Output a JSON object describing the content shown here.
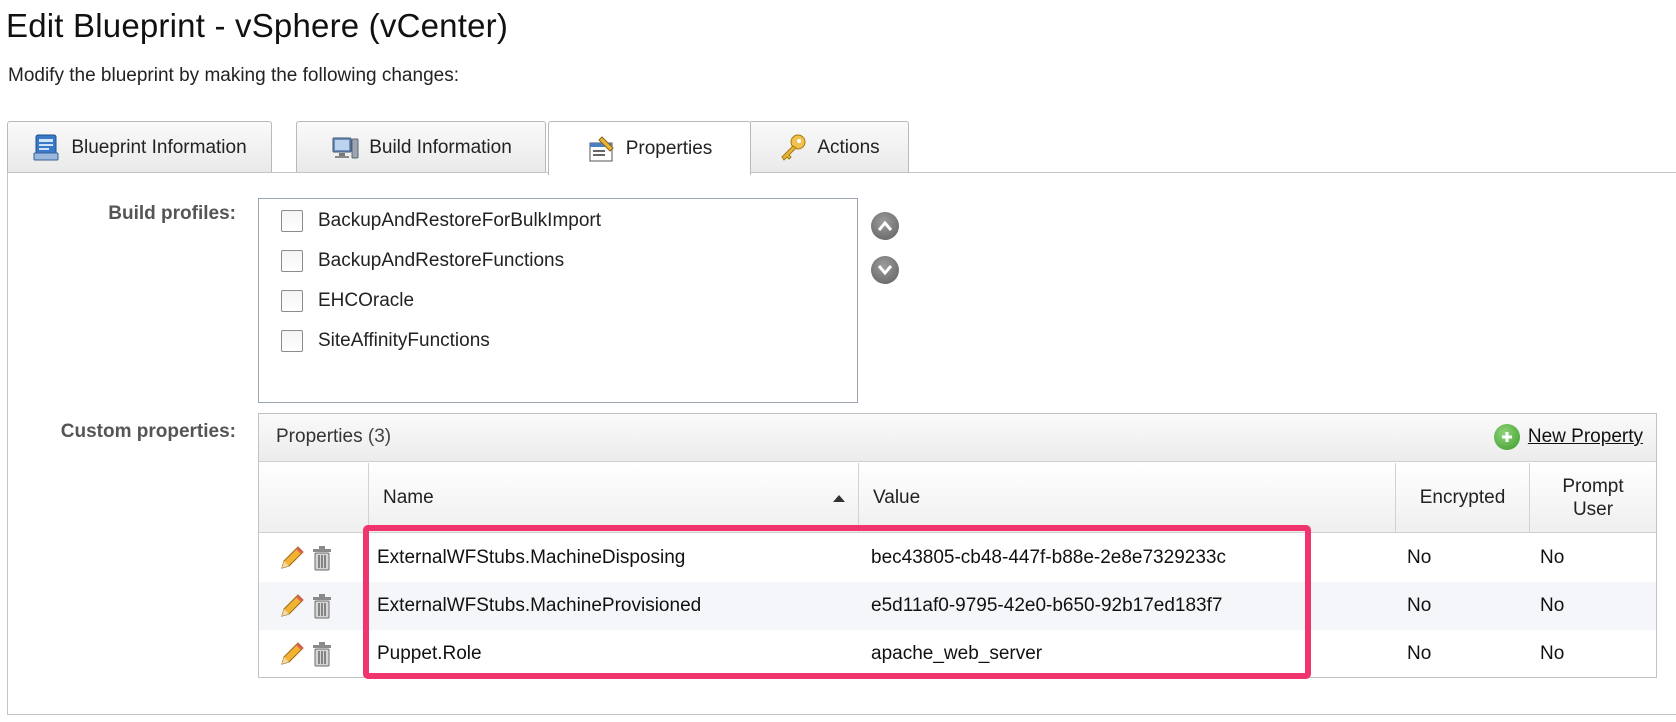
{
  "page": {
    "title": "Edit Blueprint - vSphere (vCenter)",
    "subtitle": "Modify the blueprint by making the following changes:"
  },
  "tabs": [
    {
      "label": "Blueprint Information",
      "icon": "blueprint-icon",
      "active": false
    },
    {
      "label": "Build Information",
      "icon": "build-computer-icon",
      "active": false
    },
    {
      "label": "Properties",
      "icon": "properties-icon",
      "active": true
    },
    {
      "label": "Actions",
      "icon": "key-icon",
      "active": false
    }
  ],
  "build_profiles": {
    "label": "Build profiles:",
    "items": [
      {
        "label": "BackupAndRestoreForBulkImport",
        "checked": false
      },
      {
        "label": "BackupAndRestoreFunctions",
        "checked": false
      },
      {
        "label": "EHCOracle",
        "checked": false
      },
      {
        "label": "SiteAffinityFunctions",
        "checked": false
      }
    ]
  },
  "custom_properties": {
    "label": "Custom properties:",
    "grid_title": "Properties",
    "grid_count": "(3)",
    "new_property_label": "New Property",
    "columns": {
      "name": "Name",
      "value": "Value",
      "encrypted": "Encrypted",
      "prompt_user": "Prompt User"
    },
    "sort": {
      "column": "Name",
      "direction": "ascending"
    },
    "rows": [
      {
        "name": "ExternalWFStubs.MachineDisposing",
        "value": "bec43805-cb48-447f-b88e-2e8e7329233c",
        "encrypted": "No",
        "prompt_user": "No"
      },
      {
        "name": "ExternalWFStubs.MachineProvisioned",
        "value": "e5d11af0-9795-42e0-b650-92b17ed183f7",
        "encrypted": "No",
        "prompt_user": "No"
      },
      {
        "name": "Puppet.Role",
        "value": "apache_web_server",
        "encrypted": "No",
        "prompt_user": "No"
      }
    ]
  },
  "colors": {
    "highlight": "#f0356e",
    "border": "#c5c5c5",
    "label_gray": "#555555",
    "row_alt": "#f4f6fa"
  }
}
